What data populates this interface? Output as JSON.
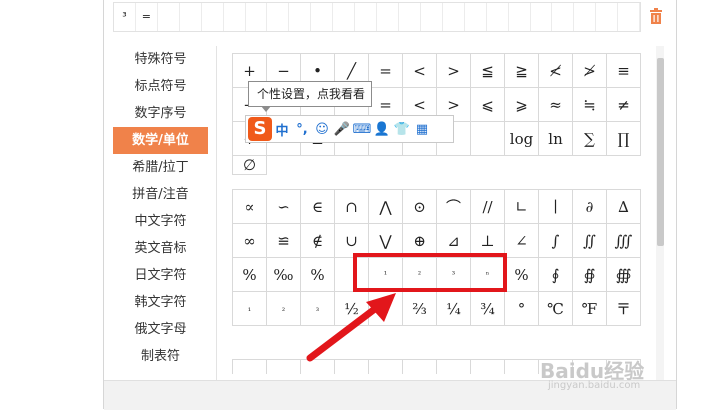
{
  "recent": {
    "symbols": [
      "³",
      "=",
      "",
      "",
      "",
      "",
      "",
      "",
      "",
      "",
      "",
      "",
      "",
      "",
      "",
      "",
      "",
      "",
      "",
      "",
      "",
      "",
      "",
      ""
    ]
  },
  "sidebar": {
    "items": [
      {
        "label": "特殊符号"
      },
      {
        "label": "标点符号"
      },
      {
        "label": "数字序号"
      },
      {
        "label": "数学/单位"
      },
      {
        "label": "希腊/拉丁"
      },
      {
        "label": "拼音/注音"
      },
      {
        "label": "中文字符"
      },
      {
        "label": "英文音标"
      },
      {
        "label": "日文字符"
      },
      {
        "label": "韩文字符"
      },
      {
        "label": "俄文字母"
      },
      {
        "label": "制表符"
      }
    ],
    "active_index": 3
  },
  "grid1": [
    "+",
    "−",
    "•",
    "╱",
    "=",
    "<",
    ">",
    "≦",
    "≧",
    "≮",
    "≯",
    "≡",
    "−",
    "",
    "",
    "",
    "=",
    "<",
    ">",
    "⩽",
    "⩾",
    "≈",
    "≒",
    "≠",
    "+",
    "",
    "±",
    "",
    "",
    "",
    "",
    "",
    "log",
    "ln",
    "∑",
    "∏",
    "∅"
  ],
  "grid2": [
    "∝",
    "∽",
    "∈",
    "∩",
    "⋀",
    "⊙",
    "⌒",
    "//",
    "∟",
    "∣",
    "∂",
    "∆",
    "∞",
    "≌",
    "∉",
    "∪",
    "⋁",
    "⊕",
    "⊿",
    "⊥",
    "∠",
    "∫",
    "∬",
    "∭",
    "%",
    "‰",
    "%",
    "",
    "¹",
    "²",
    "³",
    "ⁿ",
    "%",
    "∮",
    "∯",
    "∰",
    "₁",
    "₂",
    "₃",
    "½",
    "₃",
    "⅔",
    "¼",
    "¾",
    "°",
    "℃",
    "℉",
    "〒"
  ],
  "grid3": [
    "",
    "",
    "",
    "",
    "",
    "",
    "",
    "",
    "",
    "",
    "",
    ""
  ],
  "tooltip": {
    "text": "个性设置，点我看看"
  },
  "ime": {
    "logo": "S",
    "buttons": [
      "中",
      "°,",
      "☺",
      "🎤",
      "⌨",
      "👤",
      "👕",
      "▦"
    ]
  },
  "watermark": {
    "text": "Baidu经验",
    "sub": "jingyan.baidu.com"
  },
  "colors": {
    "accent": "#f0824a",
    "highlight": "#e2161b",
    "ime_brand": "#f05a1a"
  }
}
